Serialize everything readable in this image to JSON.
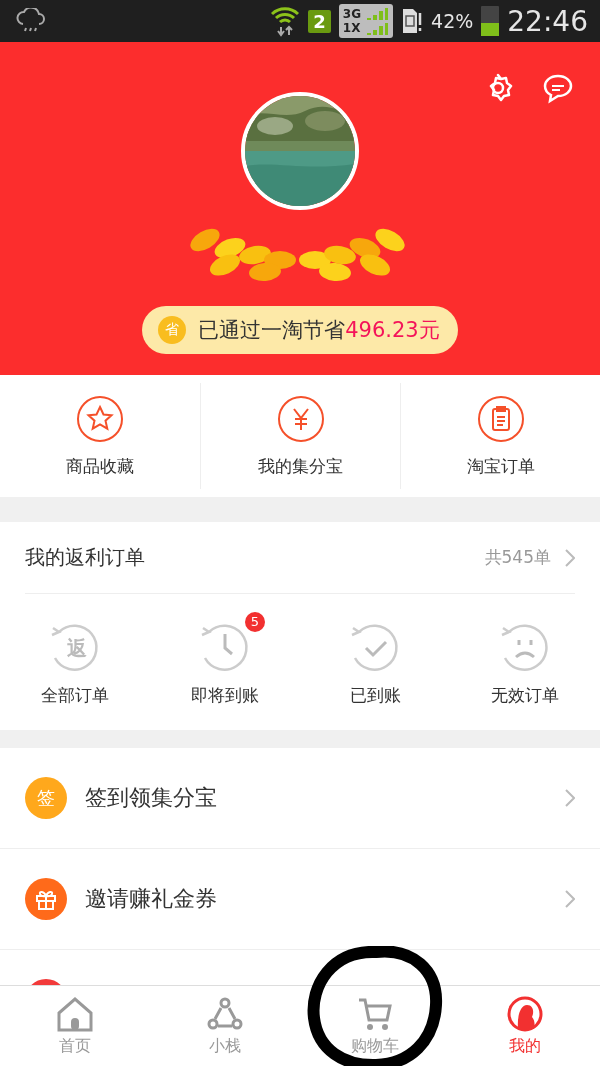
{
  "status_bar": {
    "sim_slot": "2",
    "network_top": "3G",
    "network_bottom": "1X",
    "battery_text": "42%",
    "time": "22:46"
  },
  "header": {
    "savings": {
      "icon_text": "省",
      "text": "已通过一淘节省",
      "amount": "496.23元"
    }
  },
  "quick_links": [
    {
      "kind": "star",
      "label": "商品收藏"
    },
    {
      "kind": "yen",
      "label": "我的集分宝"
    },
    {
      "kind": "clipboard",
      "label": "淘宝订单"
    }
  ],
  "orders": {
    "title": "我的返利订单",
    "count": "共545单",
    "statuses": [
      {
        "kind": "text",
        "icon_text": "返",
        "label": "全部订单"
      },
      {
        "kind": "clock",
        "label": "即将到账",
        "badge": "5"
      },
      {
        "kind": "check",
        "label": "已到账"
      },
      {
        "kind": "sad",
        "label": "无效订单"
      }
    ]
  },
  "menu": [
    {
      "kind": "text",
      "icon_text": "签",
      "label": "签到领集分宝",
      "color": "#ffa81c"
    },
    {
      "kind": "gift",
      "label": "邀请赚礼金券",
      "color": "#ff6a1a"
    },
    {
      "kind": "blank",
      "color": "#f23a3a"
    }
  ],
  "tab_bar": [
    {
      "kind": "home",
      "label": "首页",
      "selected": false
    },
    {
      "kind": "share",
      "label": "小栈",
      "selected": false
    },
    {
      "kind": "cart",
      "label": "购物车",
      "selected": false,
      "circled": true
    },
    {
      "kind": "user",
      "label": "我的",
      "selected": true
    }
  ]
}
